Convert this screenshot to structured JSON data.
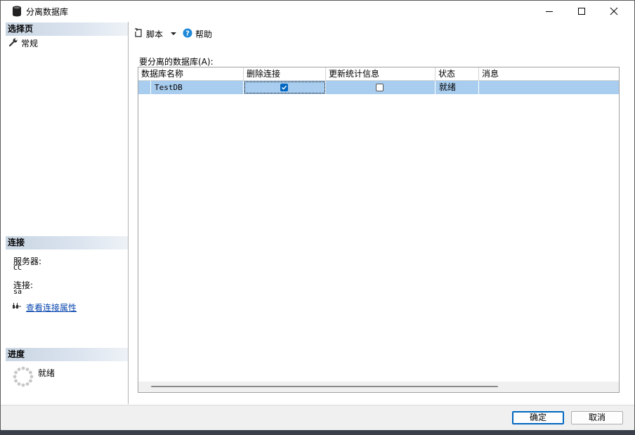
{
  "window": {
    "title": "分离数据库",
    "minimize_icon": "minimize-icon",
    "maximize_icon": "maximize-icon",
    "close_icon": "close-icon"
  },
  "left": {
    "select_page": {
      "header": "选择页",
      "items": [
        {
          "label": "常规",
          "icon": "wrench-icon"
        }
      ]
    },
    "connection": {
      "header": "连接",
      "server_label": "服务器:",
      "server_value": "CC",
      "connection_label": "连接:",
      "connection_value": "sa",
      "view_properties_link": "查看连接属性"
    },
    "progress": {
      "header": "进度",
      "status": "就绪"
    }
  },
  "toolbar": {
    "script_label": "脚本",
    "help_label": "帮助"
  },
  "grid": {
    "label": "要分离的数据库(A):",
    "columns": [
      "数据库名称",
      "删除连接",
      "更新统计信息",
      "状态",
      "消息"
    ],
    "rows": [
      {
        "name": "TestDB",
        "drop_connections": true,
        "update_statistics": false,
        "status": "就绪",
        "message": ""
      }
    ]
  },
  "buttons": {
    "ok": "确定",
    "cancel": "取消"
  },
  "colors": {
    "row_selected": "#a9cdef",
    "checkbox_checked": "#0067c0",
    "link": "#0645ad"
  }
}
